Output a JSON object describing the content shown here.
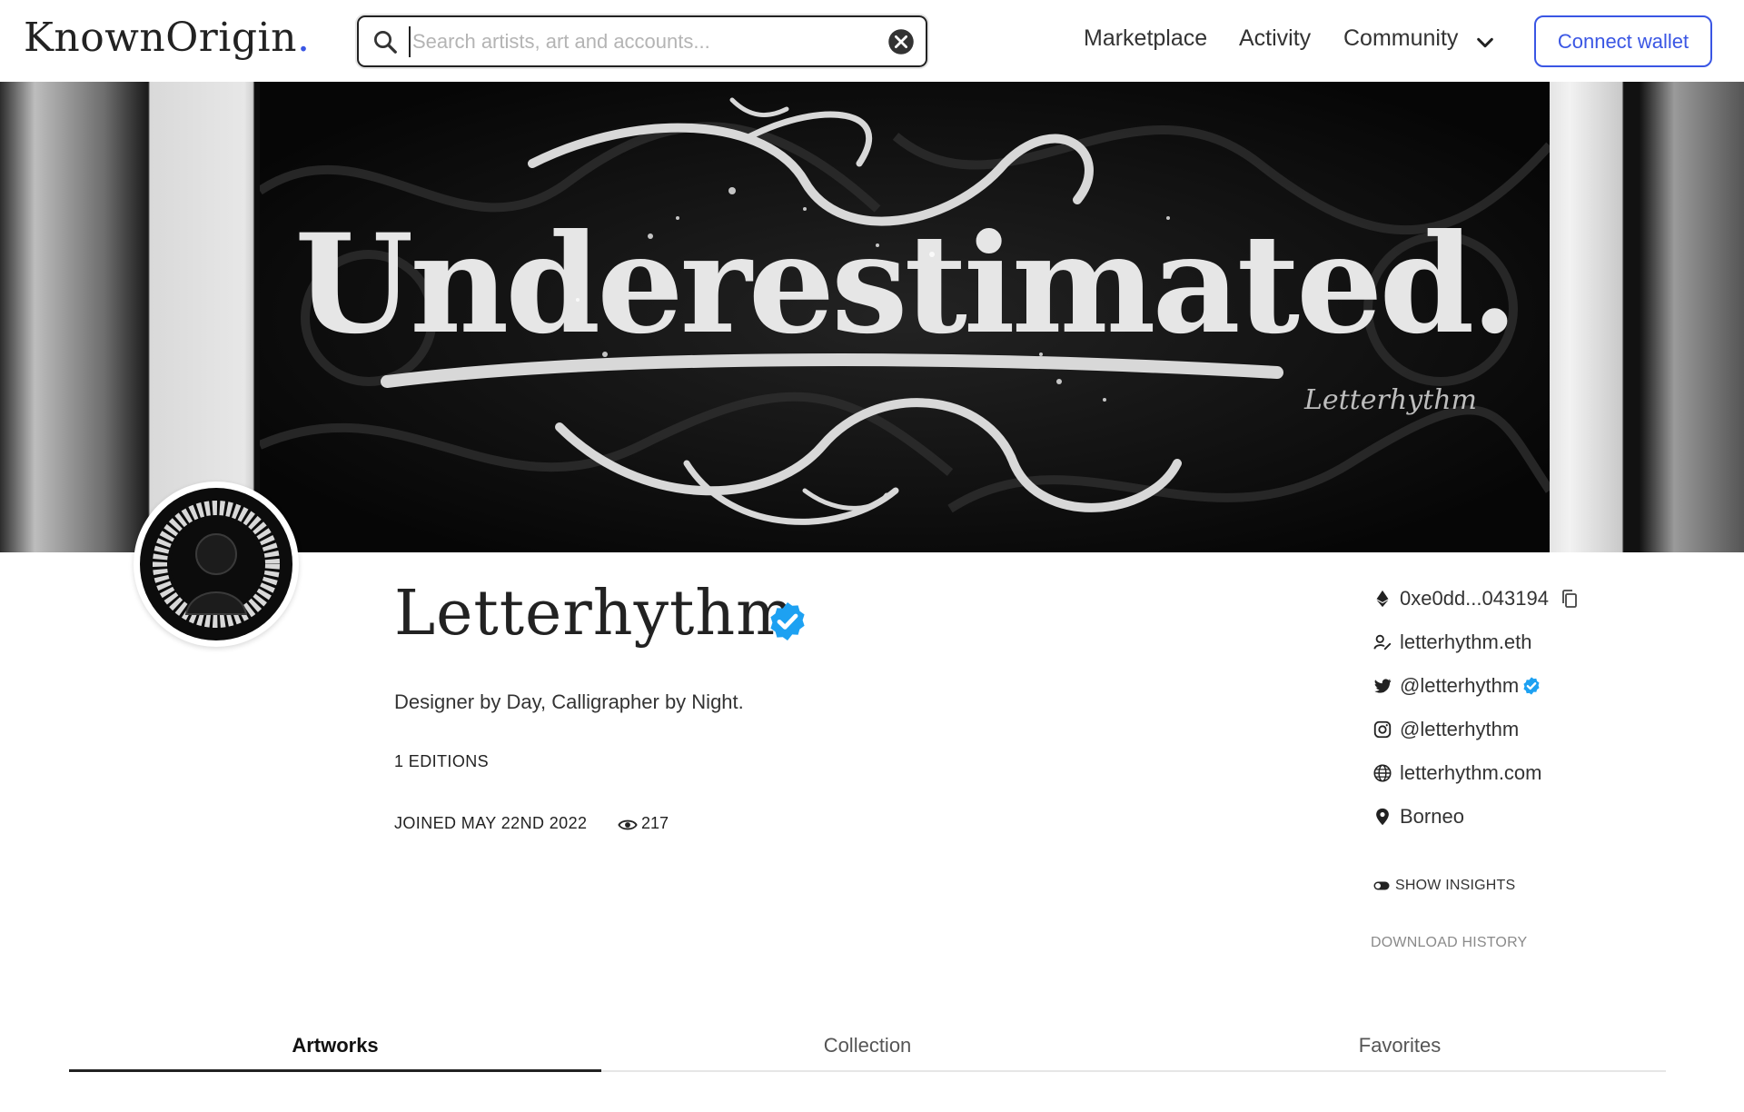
{
  "header": {
    "logo": "KnownOrigin",
    "logo_dot": ".",
    "search_placeholder": "Search artists, art and accounts...",
    "nav": {
      "marketplace": "Marketplace",
      "activity": "Activity",
      "community": "Community"
    },
    "connect_wallet": "Connect wallet",
    "accent_color": "#3a56e4"
  },
  "banner": {
    "artwork_text": "Underestimated.",
    "signature": "Letterhythm"
  },
  "profile": {
    "name": "Letterhythm",
    "verified": true,
    "bio": "Designer by Day, Calligrapher by Night.",
    "editions": "1 EDITIONS",
    "joined": "JOINED MAY 22ND 2022",
    "views": "217"
  },
  "info": {
    "address": "0xe0dd...043194",
    "ens": "letterhythm.eth",
    "twitter": "@letterhythm",
    "instagram": "@letterhythm",
    "website": "letterhythm.com",
    "location": "Borneo",
    "show_insights": "SHOW INSIGHTS",
    "download_history": "DOWNLOAD HISTORY"
  },
  "tabs": {
    "artworks": "Artworks",
    "collection": "Collection",
    "favorites": "Favorites",
    "active": "Artworks"
  },
  "icons": [
    "search-icon",
    "clear-icon",
    "chevron-down-icon",
    "verified-badge-icon",
    "eye-icon",
    "ethereum-icon",
    "copy-icon",
    "ens-icon",
    "twitter-icon",
    "instagram-icon",
    "globe-icon",
    "location-pin-icon",
    "toggle-icon"
  ],
  "colors": {
    "verified": "#1da1f2",
    "text": "#222222",
    "muted": "#8a8a8a"
  }
}
